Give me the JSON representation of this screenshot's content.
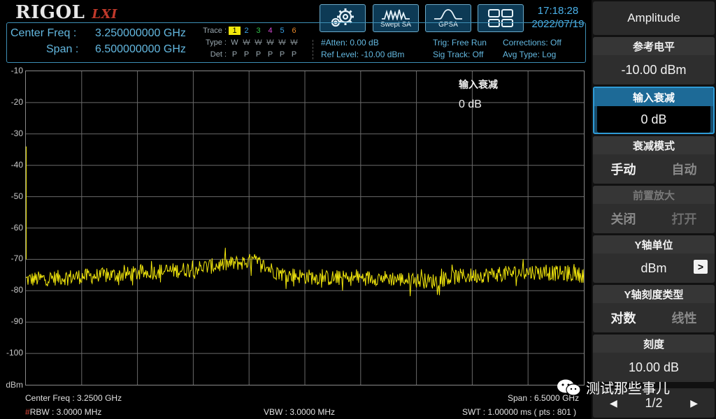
{
  "brand": {
    "logo": "RIGOL",
    "lxi": "LXI"
  },
  "modes": {
    "swept_sa": "Swept SA",
    "gpsa": "GPSA"
  },
  "clock": {
    "time": "17:18:28",
    "date": "2022/07/19"
  },
  "freq": {
    "center_label": "Center Freq :",
    "center_value": "3.250000000 GHz",
    "span_label": "Span :",
    "span_value": "6.500000000 GHz"
  },
  "trace_table": {
    "trace_label": "Trace :",
    "type_label": "Type :",
    "det_label": "Det :",
    "traces": [
      "1",
      "2",
      "3",
      "4",
      "5",
      "6"
    ],
    "types": [
      "W",
      "W",
      "W",
      "W",
      "W",
      "W"
    ],
    "dets": [
      "P",
      "P",
      "P",
      "P",
      "P",
      "P"
    ],
    "colors": [
      "#f2e70c",
      "#3aa3e6",
      "#31c24a",
      "#d64ad6",
      "#3aa3e6",
      "#e8882a"
    ]
  },
  "status": {
    "atten": "#Atten: 0.00 dB",
    "ref_level": "Ref Level: -10.00 dBm",
    "trig": "Trig: Free Run",
    "sig_track": "Sig Track: Off",
    "corrections": "Corrections: Off",
    "avg_type": "Avg Type: Log"
  },
  "graticule": {
    "y_labels": [
      "-10",
      "-20",
      "-30",
      "-40",
      "-50",
      "-60",
      "-70",
      "-80",
      "-90",
      "-100"
    ],
    "unit": "dBm",
    "ref_dbm": -10,
    "div_db": 10,
    "divisions": 10
  },
  "marker_info": {
    "title": "输入衰减",
    "value": "0 dB"
  },
  "bottom": {
    "center": "Center Freq : 3.2500 GHz",
    "span": "Span : 6.5000 GHz",
    "rbw_hash": "#",
    "rbw": "RBW : 3.0000 MHz",
    "vbw": "VBW : 3.0000 MHz",
    "swt": "SWT : 1.00000 ms ( pts : 801 )"
  },
  "trace1": {
    "color": "#f2e70c",
    "points": 801,
    "noise_floor_dbm": [
      -76.5,
      -76.0,
      -75.5,
      -75.2,
      -74.8,
      -74.0,
      -73.5,
      -72.5,
      -71.5,
      -70.5,
      -74.5,
      -75.5,
      -76.0,
      -76.0,
      -75.8,
      -76.5,
      -77.0,
      -75.5,
      -75.0,
      -74.5,
      -74.0,
      -74.5,
      -75.0
    ]
  },
  "panel": {
    "title": "Amplitude",
    "ref_level": {
      "label": "参考电平",
      "value": "-10.00 dBm"
    },
    "input_atten": {
      "label": "输入衰减",
      "value": "0 dB"
    },
    "atten_mode": {
      "label": "衰减模式",
      "on": "手动",
      "off": "自动"
    },
    "preamp": {
      "label": "前置放大",
      "on": "关闭",
      "off": "打开"
    },
    "y_unit": {
      "label": "Y轴单位",
      "value": "dBm"
    },
    "y_scale": {
      "label": "Y轴刻度类型",
      "on": "对数",
      "off": "线性"
    },
    "scale": {
      "label": "刻度",
      "value": "10.00 dB"
    },
    "page": "1/2"
  },
  "watermark": "测试那些事儿"
}
